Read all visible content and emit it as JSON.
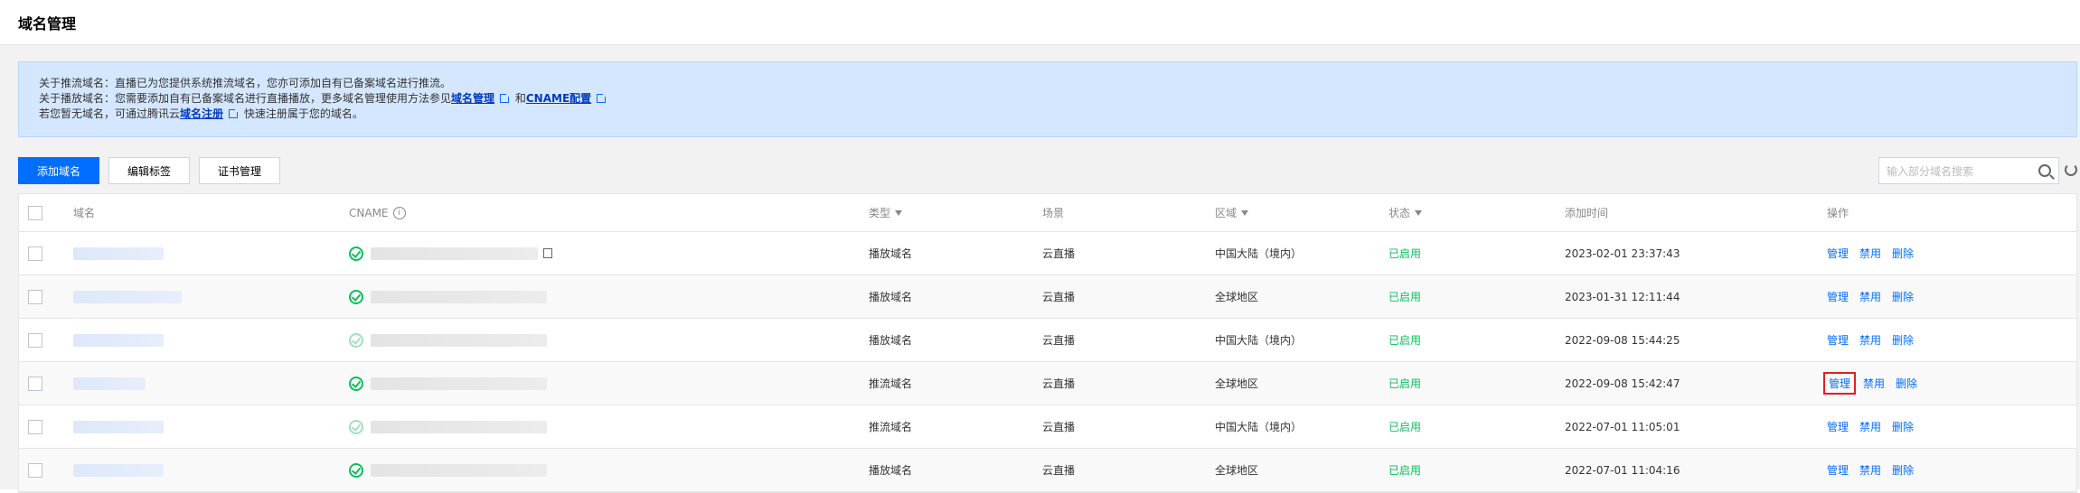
{
  "page": {
    "title": "域名管理"
  },
  "notice": {
    "line1": "关于推流域名：直播已为您提供系统推流域名，您亦可添加自有已备案域名进行推流。",
    "line2_prefix": "关于播放域名：您需要添加自有已备案域名进行直播播放，更多域名管理使用方法参见",
    "line2_link1": "域名管理",
    "line2_mid": "和",
    "line2_link2": "CNAME配置",
    "line3_prefix": "若您暂无域名，可通过腾讯云",
    "line3_link": "域名注册",
    "line3_suffix": "快速注册属于您的域名。"
  },
  "toolbar": {
    "add_domain": "添加域名",
    "edit_tags": "编辑标签",
    "cert_manage": "证书管理",
    "search_placeholder": "输入部分域名搜索"
  },
  "table": {
    "headers": {
      "name": "域名",
      "cname": "CNAME",
      "type": "类型",
      "scene": "场景",
      "region": "区域",
      "status": "状态",
      "time": "添加时间",
      "ops": "操作"
    },
    "rows": [
      {
        "type": "播放域名",
        "scene": "云直播",
        "region": "中国大陆（境内）",
        "status": "已启用",
        "time": "2023-02-01 23:37:43",
        "ops": [
          "管理",
          "禁用",
          "删除"
        ]
      },
      {
        "type": "播放域名",
        "scene": "云直播",
        "region": "全球地区",
        "status": "已启用",
        "time": "2023-01-31 12:11:44",
        "ops": [
          "管理",
          "禁用",
          "删除"
        ]
      },
      {
        "type": "播放域名",
        "scene": "云直播",
        "region": "中国大陆（境内）",
        "status": "已启用",
        "time": "2022-09-08 15:44:25",
        "ops": [
          "管理",
          "禁用",
          "删除"
        ]
      },
      {
        "type": "推流域名",
        "scene": "云直播",
        "region": "全球地区",
        "status": "已启用",
        "time": "2022-09-08 15:42:47",
        "ops": [
          "管理",
          "禁用",
          "删除"
        ]
      },
      {
        "type": "推流域名",
        "scene": "云直播",
        "region": "中国大陆（境内）",
        "status": "已启用",
        "time": "2022-07-01 11:05:01",
        "ops": [
          "管理",
          "禁用",
          "删除"
        ]
      },
      {
        "type": "播放域名",
        "scene": "云直播",
        "region": "全球地区",
        "status": "已启用",
        "time": "2022-07-01 11:04:16",
        "ops": [
          "管理",
          "禁用",
          "删除"
        ]
      }
    ]
  }
}
